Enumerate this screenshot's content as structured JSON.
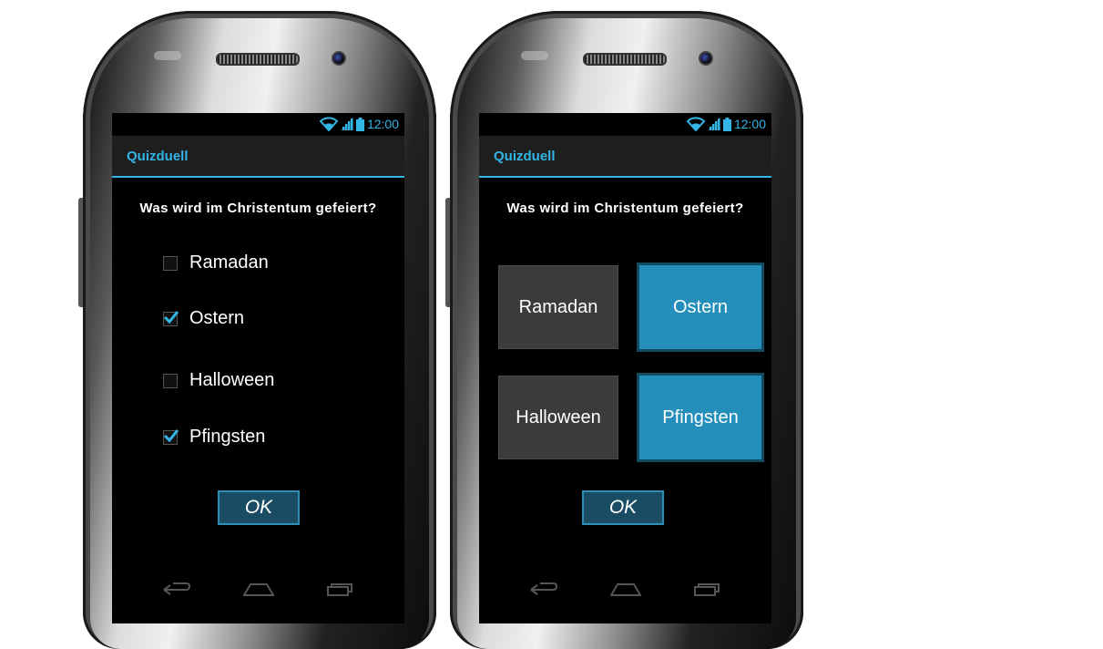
{
  "phones": [
    {
      "variant": "checkbox",
      "status_time": "12:00",
      "app_title": "Quizduell",
      "question": "Was wird im Christentum gefeiert?",
      "options": [
        {
          "label": "Ramadan",
          "checked": false
        },
        {
          "label": "Ostern",
          "checked": true
        },
        {
          "label": "Halloween",
          "checked": false
        },
        {
          "label": "Pfingsten",
          "checked": true
        }
      ],
      "ok_label": "OK"
    },
    {
      "variant": "tiles",
      "status_time": "12:00",
      "app_title": "Quizduell",
      "question": "Was wird im Christentum gefeiert?",
      "options": [
        {
          "label": "Ramadan",
          "selected": false
        },
        {
          "label": "Ostern",
          "selected": true
        },
        {
          "label": "Halloween",
          "selected": false
        },
        {
          "label": "Pfingsten",
          "selected": true
        }
      ],
      "ok_label": "OK"
    }
  ],
  "colors": {
    "accent": "#33b5e5",
    "selected_tile": "#258fbb",
    "unselected_tile": "#3b3b3b",
    "ok_button": "#1a4d63"
  },
  "icons": [
    "wifi-icon",
    "signal-icon",
    "battery-icon",
    "back-icon",
    "home-icon",
    "recent-apps-icon",
    "checkmark-icon"
  ]
}
